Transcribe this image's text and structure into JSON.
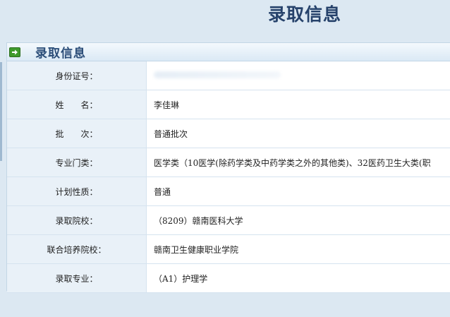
{
  "page": {
    "title": "录取信息"
  },
  "panel": {
    "title": "录取信息",
    "icon": "arrow-right-icon",
    "icon_color": "#3f9a2c"
  },
  "rows": [
    {
      "label": "身份证号：",
      "value": ""
    },
    {
      "label": "姓　　名：",
      "value": "李佳琳"
    },
    {
      "label": "批　　次：",
      "value": "普通批次"
    },
    {
      "label": "专业门类：",
      "value": "医学类（10医学(除药学类及中药学类之外的其他类)、32医药卫生大类(职"
    },
    {
      "label": "计划性质：",
      "value": "普通"
    },
    {
      "label": "录取院校：",
      "value": "（8209）赣南医科大学"
    },
    {
      "label": "联合培养院校：",
      "value": "赣南卫生健康职业学院"
    },
    {
      "label": "录取专业：",
      "value": "（A1）护理学"
    }
  ],
  "colors": {
    "background": "#dce8f2",
    "title_text": "#26426b",
    "label_bg": "#e9f1f8",
    "border": "#d5e3ef"
  }
}
